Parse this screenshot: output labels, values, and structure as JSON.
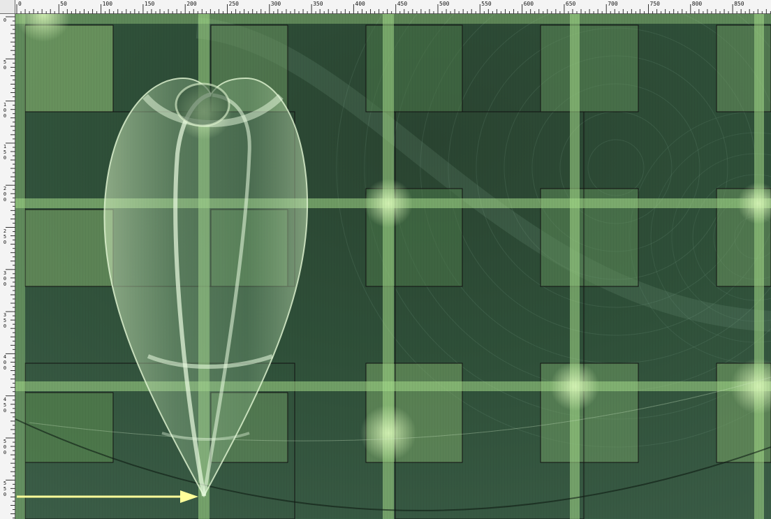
{
  "ruler": {
    "units": "px",
    "top_labels": [
      "0",
      "50",
      "100",
      "150",
      "200",
      "250",
      "300",
      "350",
      "400",
      "450",
      "500",
      "550",
      "600",
      "650",
      "700",
      "750",
      "800",
      "850"
    ],
    "left_labels": [
      "0",
      "50",
      "100",
      "150",
      "200",
      "250",
      "300",
      "350",
      "400",
      "450",
      "500",
      "550"
    ]
  },
  "colors": {
    "ruler_bg": "#f4f4f4",
    "canvas_dark": "#24412f",
    "canvas_mid": "#3f6a4c",
    "grid_bar": "#9fd889",
    "tile": "#6f9c64",
    "arrow": "#ffffa0"
  },
  "canvas": {
    "name": "green-abstract-artwork",
    "elements": [
      "grid-tiles",
      "light-bars",
      "concentric-circles",
      "glass-drop-shape",
      "arrow-pointer"
    ]
  }
}
